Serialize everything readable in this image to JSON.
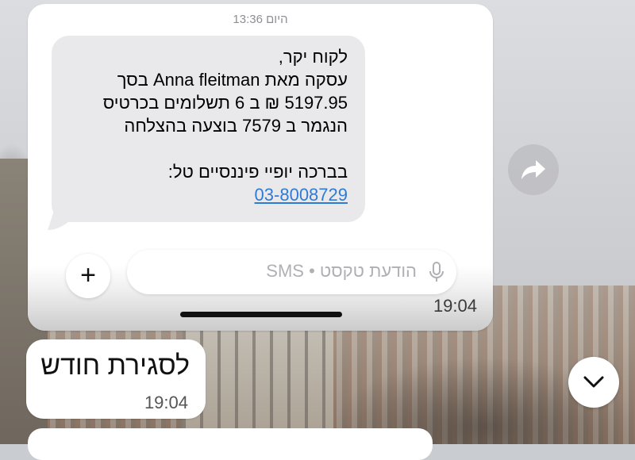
{
  "sms_card": {
    "date_label": "היום 13:36",
    "message_lines": [
      "לקוח יקר,",
      "עסקה מאת Anna fleitman בסך",
      "5197.95 ₪ ב 6 תשלומים בכרטיס",
      "הנגמר ב 7579 בוצעה בהצלחה",
      "",
      "בברכה יופיי פיננסיים טל:"
    ],
    "phone_link": "03-8008729",
    "input_placeholder": "הודעת טקסט • SMS",
    "plus_label": "+",
    "time": "19:04"
  },
  "caption": {
    "text": "לסגירת חודש",
    "time": "19:04"
  },
  "icons": {
    "forward": "forward-arrow-icon",
    "scroll": "chevron-down-icon",
    "mic": "microphone-icon"
  },
  "colors": {
    "link": "#2e7bd6",
    "sms_bubble": "#e9e9eb"
  }
}
